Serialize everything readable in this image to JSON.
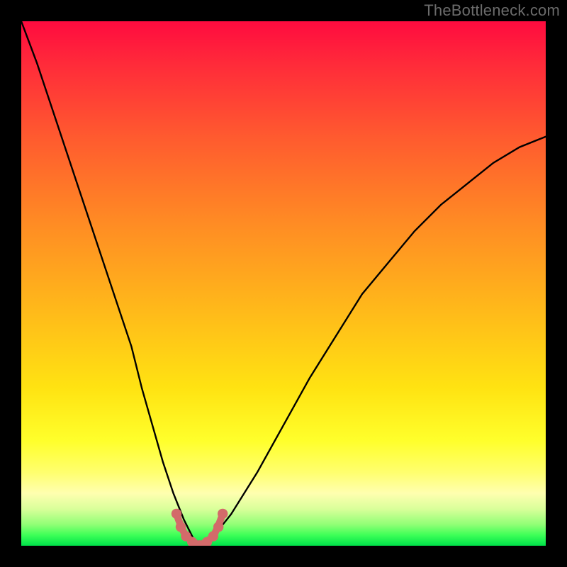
{
  "attribution": "TheBottleneck.com",
  "chart_data": {
    "type": "line",
    "title": "",
    "xlabel": "",
    "ylabel": "",
    "xlim": [
      0,
      100
    ],
    "ylim": [
      0,
      100
    ],
    "background_gradient_stops": [
      {
        "pct": 0,
        "color": "#ff0b3f"
      },
      {
        "pct": 8,
        "color": "#ff2a3a"
      },
      {
        "pct": 22,
        "color": "#ff5a2f"
      },
      {
        "pct": 38,
        "color": "#ff8a24"
      },
      {
        "pct": 55,
        "color": "#ffb91a"
      },
      {
        "pct": 70,
        "color": "#ffe312"
      },
      {
        "pct": 80,
        "color": "#ffff2b"
      },
      {
        "pct": 86,
        "color": "#ffff6e"
      },
      {
        "pct": 90,
        "color": "#ffffb0"
      },
      {
        "pct": 93,
        "color": "#d9ff9a"
      },
      {
        "pct": 96,
        "color": "#8fff75"
      },
      {
        "pct": 98,
        "color": "#3cff57"
      },
      {
        "pct": 100,
        "color": "#00e24a"
      }
    ],
    "series": [
      {
        "name": "bottleneck-curve",
        "color": "#000000",
        "x": [
          0,
          3,
          6,
          9,
          12,
          15,
          18,
          21,
          23,
          25,
          27,
          29,
          31,
          33,
          34,
          36,
          40,
          45,
          50,
          55,
          60,
          65,
          70,
          75,
          80,
          85,
          90,
          95,
          100
        ],
        "y": [
          100,
          92,
          83,
          74,
          65,
          56,
          47,
          38,
          30,
          23,
          16,
          10,
          5,
          1,
          0,
          1,
          6,
          14,
          23,
          32,
          40,
          48,
          54,
          60,
          65,
          69,
          73,
          76,
          78
        ]
      }
    ],
    "markers": {
      "name": "highlight-dots",
      "color": "#d36a6a",
      "x": [
        29.6,
        30.4,
        31.4,
        32.6,
        34.0,
        35.4,
        36.6,
        37.6,
        38.4
      ],
      "y": [
        6.1,
        3.6,
        1.8,
        0.7,
        0.1,
        0.7,
        1.8,
        3.6,
        6.1
      ]
    },
    "minimum": {
      "x": 34,
      "y": 0
    }
  }
}
